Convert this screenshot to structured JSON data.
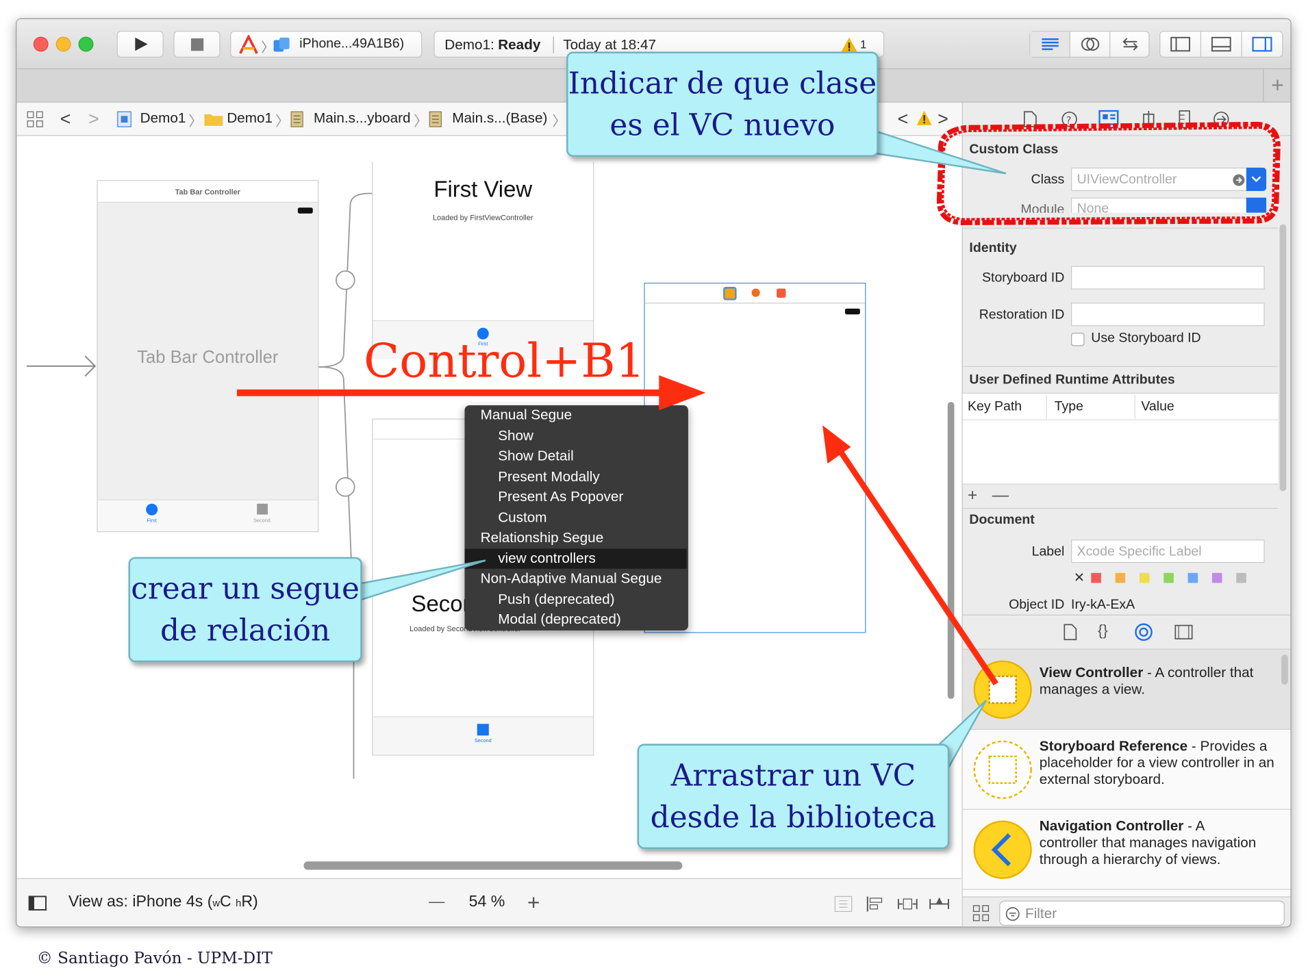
{
  "toolbar": {
    "scheme": "iPhone...49A1B6)",
    "status_project": "Demo1:",
    "status_state": "Ready",
    "status_time": "Today at 18:47",
    "warning_count": "1",
    "add_tab": "+"
  },
  "jumpbar": {
    "crumbs": [
      "Demo1",
      "Demo1",
      "Main.s...yboard",
      "Main.s...(Base)"
    ]
  },
  "canvas": {
    "tabbar_scene_title": "Tab Bar Controller",
    "tabbar_label": "Tab Bar Controller",
    "tab_first": "First",
    "tab_second": "Second",
    "first_view_title": "First View",
    "first_view_subtitle": "Loaded by FirstViewController",
    "first_tab": "First",
    "second_view_title": "Second View",
    "second_view_subtitle": "Loaded by SecondViewController",
    "second_tab": "Second"
  },
  "segue_menu": {
    "items": [
      {
        "label": "Manual Segue",
        "header": true
      },
      {
        "label": "Show",
        "header": false
      },
      {
        "label": "Show Detail",
        "header": false
      },
      {
        "label": "Present Modally",
        "header": false
      },
      {
        "label": "Present As Popover",
        "header": false
      },
      {
        "label": "Custom",
        "header": false
      },
      {
        "label": "Relationship Segue",
        "header": true
      },
      {
        "label": "view controllers",
        "header": false,
        "selected": true
      },
      {
        "label": "Non-Adaptive Manual Segue",
        "header": true
      },
      {
        "label": "Push (deprecated)",
        "header": false
      },
      {
        "label": "Modal (deprecated)",
        "header": false
      }
    ]
  },
  "annotations": {
    "control_b1": "Control+B1",
    "callout_class_line1": "Indicar de que clase",
    "callout_class_line2": "es el VC nuevo",
    "callout_segue_line1": "crear un segue",
    "callout_segue_line2": "de relación",
    "callout_drag_line1": "Arrastrar un VC",
    "callout_drag_line2": "desde la biblioteca",
    "arrow_color": "#ff2d10",
    "highlight_color": "#e81010"
  },
  "bottombar": {
    "view_as": "View as: iPhone 4s (",
    "size_w": "w",
    "size_c": "C",
    "size_h": "h",
    "size_r": "R)",
    "zoom_minus": "—",
    "zoom": "54 %",
    "zoom_plus": "+"
  },
  "inspector": {
    "custom_class_header": "Custom Class",
    "class_label": "Class",
    "class_placeholder": "UIViewController",
    "module_label": "Module",
    "module_placeholder": "None",
    "identity_header": "Identity",
    "storyboard_id_label": "Storyboard ID",
    "restoration_id_label": "Restoration ID",
    "use_storyboard_id": "Use Storyboard ID",
    "udra_header": "User Defined Runtime Attributes",
    "col_key_path": "Key Path",
    "col_type": "Type",
    "col_value": "Value",
    "add_remove": "+ —",
    "document_header": "Document",
    "label_label": "Label",
    "label_placeholder": "Xcode Specific Label",
    "swatch_x": "✕",
    "swatch_colors": [
      "#f25a5a",
      "#f5b04c",
      "#f0dd4e",
      "#8fd65e",
      "#6aa9f2",
      "#c48ae6",
      "#bcbcbc"
    ],
    "object_id_label": "Object ID",
    "object_id_value": "Iry-kA-ExA"
  },
  "library": {
    "items": [
      {
        "title": "View Controller",
        "desc_first": " - A controller that",
        "desc_rest": "manages a view."
      },
      {
        "title": "Storyboard Reference",
        "desc_first": " - Provides a",
        "desc_rest": "placeholder for a view controller in an external storyboard."
      },
      {
        "title": "Navigation Controller",
        "desc_first": " - A",
        "desc_rest": "controller that manages navigation through a hierarchy of views."
      }
    ],
    "filter_placeholder": "Filter"
  },
  "footer": {
    "copyright": "© Santiago Pavón - UPM-DIT"
  }
}
